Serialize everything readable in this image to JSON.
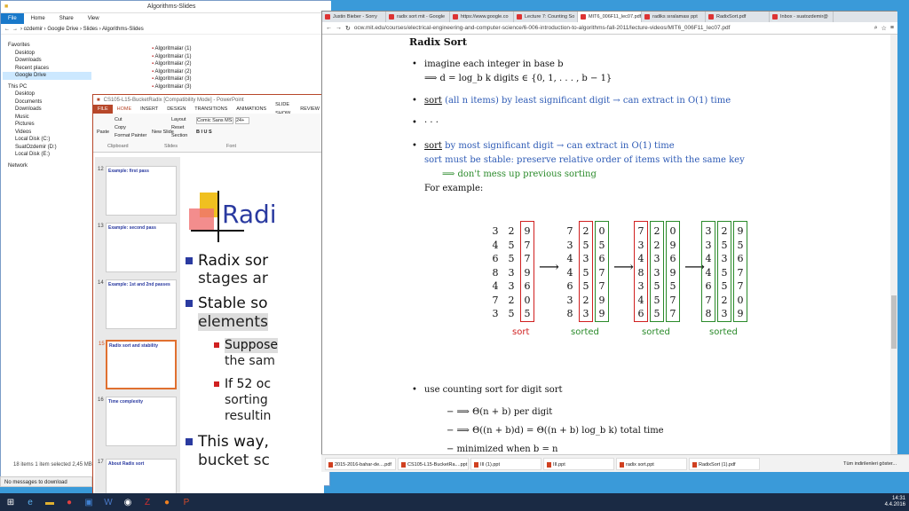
{
  "explorer": {
    "title": "Algorithms-Slides",
    "tabs": [
      "File",
      "Home",
      "Share",
      "View"
    ],
    "breadcrumb": "› ozdemir › Google Drive › Slides › Algorithms-Slides",
    "nav": {
      "favorites": "Favorites",
      "items": [
        "Desktop",
        "Downloads",
        "Recent places",
        "Google Drive"
      ],
      "thispc": "This PC",
      "pc_items": [
        "Desktop",
        "Documents",
        "Downloads",
        "Music",
        "Pictures",
        "Videos",
        "Local Disk (C:)",
        "SuatOzdemir (D:)",
        "Local Disk (E:)"
      ],
      "network": "Network"
    },
    "files": [
      "Algoritmalar (1)",
      "Algoritmalar (1)",
      "Algoritmalar (2)",
      "Algoritmalar (2)",
      "Algoritmalar (3)",
      "Algoritmalar (3)"
    ],
    "status": "18 items    1 item selected  2,45 MB"
  },
  "ppt": {
    "title": "CS105-L15-BucketRadix [Compatibility Mode] - PowerPoint",
    "tabs": [
      "FILE",
      "HOME",
      "INSERT",
      "DESIGN",
      "TRANSITIONS",
      "ANIMATIONS",
      "SLIDE SHOW",
      "REVIEW"
    ],
    "ribbon": {
      "paste": "Paste",
      "cut": "Cut",
      "copy": "Copy",
      "format_painter": "Format Painter",
      "new_slide": "New Slide",
      "layout": "Layout",
      "reset": "Reset",
      "section": "Section",
      "font": "Comic Sans MS",
      "size": "24+",
      "clipboard": "Clipboard",
      "slides": "Slides",
      "font_group": "Font"
    },
    "thumbs": [
      {
        "n": "12",
        "t": "Example: first pass"
      },
      {
        "n": "13",
        "t": "Example: second pass"
      },
      {
        "n": "14",
        "t": "Example: 1st and 2nd passes"
      },
      {
        "n": "15",
        "t": "Radix sort and stability"
      },
      {
        "n": "16",
        "t": "Time complexity"
      },
      {
        "n": "17",
        "t": "About Radix sort"
      }
    ],
    "slide": {
      "title": "Radi",
      "b1a": "Radix sor",
      "b1b": "stages ar",
      "b2a": "Stable so",
      "b2b": "elements",
      "s1a": "Suppose",
      "s1b": "the sam",
      "s2a": "If 52 oc",
      "s2b": "sorting",
      "s2c": "resultin",
      "b3a": "This way,",
      "b3b": "bucket sc"
    }
  },
  "browser": {
    "tabs": [
      "Justin Bieber - Sorry",
      "radix sort mit - Google",
      "https://www.google.co",
      "Lecture 7: Counting So",
      "MIT6_006F11_lec07.pdf",
      "radiks sıralaması ppt",
      "RadixSort.pdf",
      "Inbox - suatozdemir@"
    ],
    "url": "ocw.mit.edu/courses/electrical-engineering-and-computer-science/6-006-introduction-to-algorithms-fall-2011/lecture-videos/MIT6_006F11_lec07.pdf",
    "doc": {
      "heading": "Radix Sort",
      "l1": "imagine each integer in base b",
      "l2": "⟹  d = log_b k digits ∈ {0, 1, . . . , b − 1}",
      "l3a": "sort",
      "l3b": "(all n items) by least significant digit → can extract in O(1) time",
      "l4": "· · ·",
      "l5a": "sort",
      "l5b": "by most significant digit → can extract in O(1) time",
      "l6": "sort must be stable: preserve relative order of items with the same key",
      "l7": "⟹  don't mess up previous sorting",
      "l8": "For example:",
      "cols": [
        [
          "329",
          "457",
          "657",
          "839",
          "436",
          "720",
          "355"
        ],
        [
          "720",
          "355",
          "436",
          "457",
          "657",
          "329",
          "839"
        ],
        [
          "720",
          "329",
          "436",
          "839",
          "355",
          "457",
          "657"
        ],
        [
          "329",
          "355",
          "436",
          "457",
          "657",
          "720",
          "839"
        ]
      ],
      "labels": [
        "sort",
        "sorted",
        "sorted",
        "sorted"
      ],
      "l9": "use counting sort for digit sort",
      "l10": "−  ⟹  Θ(n + b) per digit",
      "l11": "−  ⟹  Θ((n + b)d) = Θ((n + b) log_b k) total time",
      "l12": "−  minimized when b = n"
    }
  },
  "downloads": [
    "2015-2016-bahar-de....pdf",
    "CS105-L15-BucketRa....ppt",
    "III (1).ppt",
    "III.ppt",
    "radix sort.ppt",
    "RadixSort (1).pdf"
  ],
  "downloads_all": "Tüm indirilenleri göster...",
  "nomsg": "No messages to download",
  "clock": {
    "time": "14:31",
    "date": "4.4.2016"
  }
}
